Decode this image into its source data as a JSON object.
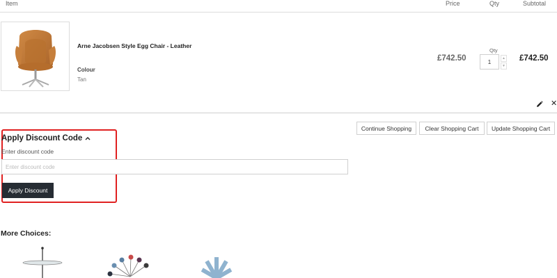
{
  "table_header": {
    "item": "Item",
    "price": "Price",
    "qty": "Qty",
    "subtotal": "Subtotal"
  },
  "cart_item": {
    "image_icon": "egg-chair-image",
    "name": "Arne Jacobsen Style Egg Chair - Leather",
    "option_label": "Colour",
    "option_value": "Tan",
    "price": "£742.50",
    "qty_label": "Qty",
    "qty_value": "1",
    "subtotal": "£742.50"
  },
  "icons": {
    "edit": "pencil-icon",
    "remove": "close-icon",
    "chevron": "chevron-up-icon"
  },
  "actions": {
    "continue_shopping": "Continue Shopping",
    "clear_cart": "Clear Shopping Cart",
    "update_cart": "Update Shopping Cart"
  },
  "discount": {
    "title": "Apply Discount Code",
    "label": "Enter discount code",
    "placeholder": "Enter discount code",
    "button": "Apply Discount"
  },
  "more_choices": {
    "title": "More Choices:"
  },
  "colors": {
    "highlight": "#e02020",
    "primary_button": "#262c33",
    "border": "#cfcfcf"
  }
}
